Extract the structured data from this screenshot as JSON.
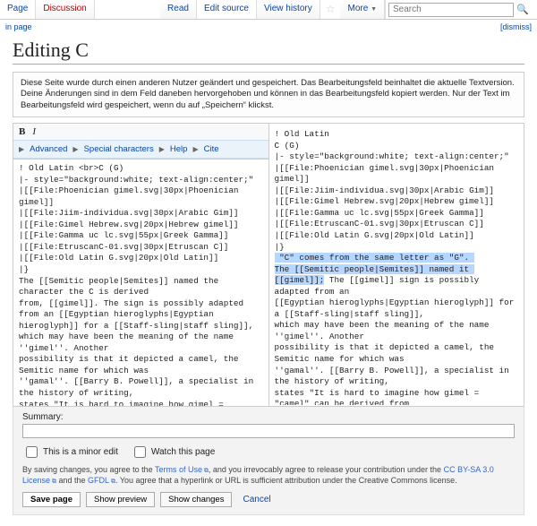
{
  "tabs": {
    "left": [
      "Page",
      "Discussion"
    ],
    "right": [
      "Read",
      "Edit source",
      "View history",
      "More"
    ]
  },
  "search": {
    "placeholder": "Search"
  },
  "subrow": {
    "left": "in page",
    "right": "[dismiss]"
  },
  "heading": "Editing C",
  "notice": "Diese Seite wurde durch einen anderen Nutzer geändert und gespeichert. Das Bearbeitungsfeld beinhaltet die aktuelle Textversion. Deine Änderungen sind in dem Feld daneben hervorgehoben und können in das Bearbeitungsfeld kopiert werden. Nur der Text im Bearbeitungsfeld wird gespeichert, wenn du auf „Speichern“ klickst.",
  "toolbar": {
    "bold": "B",
    "italic": "I",
    "items": [
      "Advanced",
      "Special characters",
      "Help",
      "Cite"
    ]
  },
  "leftcode": "! Old Latin <br>C (G)\n|- style=\"background:white; text-align:center;\"\n|[[File:Phoenician gimel.svg|30px|Phoenician gimel]]\n|[[File:Jiim-individua.svg|30px|Arabic Gim]]\n|[[File:Gimel Hebrew.svg|20px|Hebrew gimel]]\n|[[File:Gamma uc lc.svg|55px|Greek Gamma]]\n|[[File:EtruscanC-01.svg|30px|Etruscan C]]\n|[[File:Old Latin G.svg|20px|Old Latin]]\n|}\nThe [[Semitic people|Semites]] named the character the C is derived\nfrom, [[gimel]]. The sign is possibly adapted from an [[Egyptian hieroglyphs|Egyptian hieroglyph]] for a [[Staff-sling|staff sling]],\nwhich may have been the meaning of the name ''gimel''. Another\npossibility is that it depicted a camel, the Semitic name for which was\n''gamal''. [[Barry B. Powell]], a specialist in the history of writing,\nstates \"It is hard to imagine how gimel = \"camel\" can be derived from\nthe picture of a camel (it may show his hump, or his head and\nneck!)\".<ref>{{cite book|last=Powell|first=Barry B.|title=Writing: Theory and History of the Technology of Civilization|date=27 Mar 2009|publisher=Wiley",
  "rightcode_pre": "! Old Latin\nC (G)\n|- style=\"background:white; text-align:center;\"\n|[[File:Phoenician gimel.svg|30px|Phoenician gimel]]\n|[[File:Jiim-individua.svg|30px|Arabic Gim]]\n|[[File:Gimel Hebrew.svg|20px|Hebrew gimel]]\n|[[File:Gamma uc lc.svg|55px|Greek Gamma]]\n|[[File:EtruscanC-01.svg|30px|Etruscan C]]\n|[[File:Old Latin G.svg|20px|Old Latin]]\n|}\n",
  "rightcode_hl": " \"C\" comes from the same letter as \"G\". \nThe [[Semitic people|Semites]] named it [[gimel]];",
  "rightcode_post": " The [[gimel]] sign is possibly adapted from an\n[[Egyptian hieroglyphs|Egyptian hieroglyph]] for a [[Staff-sling|staff sling]],\nwhich may have been the meaning of the name ''gimel''. Another\npossibility is that it depicted a camel, the Semitic name for which was\n''gamal''. [[Barry B. Powell]], a specialist in the history of writing,\nstates \"It is hard to imagine how gimel = \"camel\" can be derived from\nthe picture of a camel (it may show his hump, or his head and\nneck!)\".{{cite book|last=Powell|first=Barry",
  "bottom": {
    "summary_label": "Summary:",
    "minor": "This is a minor edit",
    "watch": "Watch this page",
    "legal_pre": "By saving changes, you agree to the ",
    "terms": "Terms of Use",
    "legal_mid": ", and you irrevocably agree to release your contribution under the ",
    "cc": "CC BY-SA 3.0 License",
    "and": " and the ",
    "gfdl": "GFDL",
    "legal_post": ". You agree that a hyperlink or URL is sufficient attribution under the Creative Commons license.",
    "save": "Save page",
    "preview": "Show preview",
    "changes": "Show changes",
    "cancel": "Cancel"
  }
}
